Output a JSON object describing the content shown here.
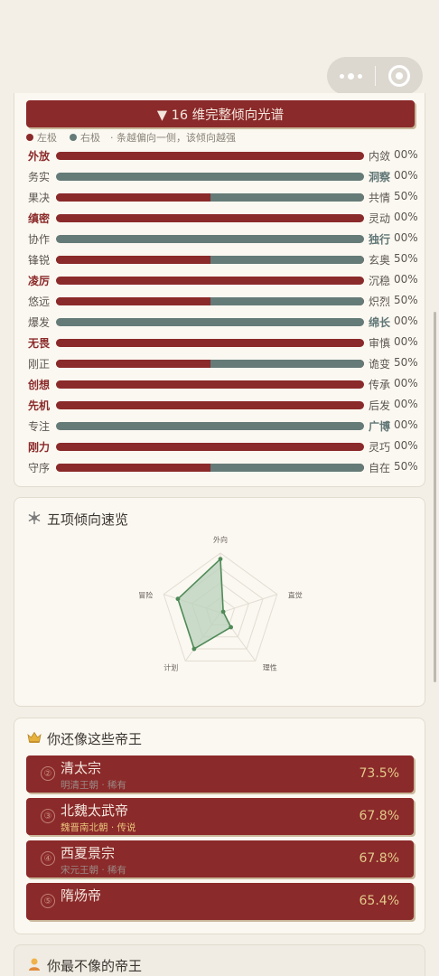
{
  "capsule": {
    "menu_icon": "more-dots-icon",
    "close_icon": "target-circle-icon"
  },
  "spectrum": {
    "toggle_label": "▼ 16 维完整倾向光谱",
    "legend": {
      "left": "左极",
      "right": "右极",
      "note": "· 条越偏向一侧，该倾向越强"
    },
    "colors": {
      "left": "#8b2a2a",
      "right": "#657b78"
    },
    "rows": [
      {
        "left": "外放",
        "right": "内敛",
        "pct": "00%",
        "left_strong": true,
        "right_strong": false,
        "left_share": 1.0
      },
      {
        "left": "务实",
        "right": "洞察",
        "pct": "00%",
        "left_strong": false,
        "right_strong": true,
        "left_share": 0.0
      },
      {
        "left": "果决",
        "right": "共情",
        "pct": "50%",
        "left_strong": false,
        "right_strong": false,
        "left_share": 0.5
      },
      {
        "left": "缜密",
        "right": "灵动",
        "pct": "00%",
        "left_strong": true,
        "right_strong": false,
        "left_share": 1.0
      },
      {
        "left": "协作",
        "right": "独行",
        "pct": "00%",
        "left_strong": false,
        "right_strong": true,
        "left_share": 0.0
      },
      {
        "left": "锋锐",
        "right": "玄奥",
        "pct": "50%",
        "left_strong": false,
        "right_strong": false,
        "left_share": 0.5
      },
      {
        "left": "凌厉",
        "right": "沉稳",
        "pct": "00%",
        "left_strong": true,
        "right_strong": false,
        "left_share": 1.0
      },
      {
        "left": "悠远",
        "right": "炽烈",
        "pct": "50%",
        "left_strong": false,
        "right_strong": false,
        "left_share": 0.5
      },
      {
        "left": "爆发",
        "right": "绵长",
        "pct": "00%",
        "left_strong": false,
        "right_strong": true,
        "left_share": 0.0
      },
      {
        "left": "无畏",
        "right": "审慎",
        "pct": "00%",
        "left_strong": true,
        "right_strong": false,
        "left_share": 1.0
      },
      {
        "left": "刚正",
        "right": "诡变",
        "pct": "50%",
        "left_strong": false,
        "right_strong": false,
        "left_share": 0.5
      },
      {
        "left": "创想",
        "right": "传承",
        "pct": "00%",
        "left_strong": true,
        "right_strong": false,
        "left_share": 1.0
      },
      {
        "left": "先机",
        "right": "后发",
        "pct": "00%",
        "left_strong": true,
        "right_strong": false,
        "left_share": 1.0
      },
      {
        "left": "专注",
        "right": "广博",
        "pct": "00%",
        "left_strong": false,
        "right_strong": true,
        "left_share": 0.0
      },
      {
        "left": "刚力",
        "right": "灵巧",
        "pct": "00%",
        "left_strong": true,
        "right_strong": false,
        "left_share": 1.0
      },
      {
        "left": "守序",
        "right": "自在",
        "pct": "50%",
        "left_strong": false,
        "right_strong": false,
        "left_share": 0.5
      }
    ]
  },
  "radar": {
    "icon": "snowflake-icon",
    "title": "五项倾向速览",
    "chart_data": {
      "type": "radar",
      "axes": [
        "外向",
        "直觉",
        "理性",
        "计划",
        "冒险"
      ],
      "values": [
        0.9,
        0.05,
        0.3,
        0.75,
        0.75
      ],
      "range": [
        0,
        1
      ],
      "rings": 4,
      "fill": "#b9d2bb",
      "stroke": "#4f8a58"
    }
  },
  "similar": {
    "icon": "crown-icon",
    "title": "你还像这些帝王",
    "items": [
      {
        "rank": "②",
        "name": "清太宗",
        "dynasty": "明清王朝",
        "rarity": "稀有",
        "score": "73.5%",
        "meta_color": "#9a8a86"
      },
      {
        "rank": "③",
        "name": "北魏太武帝",
        "dynasty": "魏晋南北朝",
        "rarity": "传说",
        "score": "67.8%",
        "meta_color": "#e8c17a"
      },
      {
        "rank": "④",
        "name": "西夏景宗",
        "dynasty": "宋元王朝",
        "rarity": "稀有",
        "score": "67.8%",
        "meta_color": "#9a8a86"
      },
      {
        "rank": "⑤",
        "name": "隋炀帝",
        "dynasty": "",
        "rarity": "",
        "score": "65.4%",
        "meta_color": "#9a8a86"
      }
    ]
  },
  "least": {
    "icon": "person-icon",
    "title": "你最不像的帝王"
  }
}
